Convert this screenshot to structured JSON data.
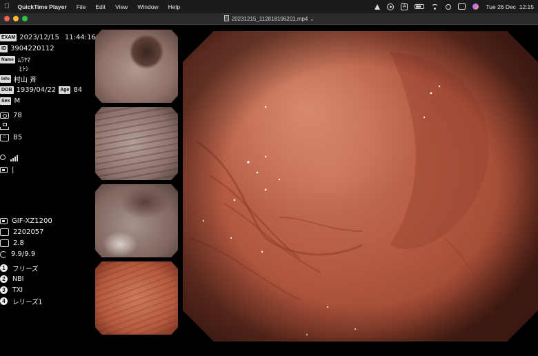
{
  "menubar": {
    "app_name": "QuickTime Player",
    "menus": [
      "File",
      "Edit",
      "View",
      "Window",
      "Help"
    ],
    "status_a_label": "A",
    "clock": "Tue 26 Dec  12:15"
  },
  "window": {
    "title": "20231215_112818106201.mp4",
    "title_chevron": "⌄"
  },
  "patient": {
    "exam_tag": "EXAM",
    "exam_date": "2023/12/15",
    "exam_time": "11:44:16",
    "id_tag": "ID",
    "id_value": "3904220112",
    "name_tag": "Name",
    "name_kana_family": "ﾑﾗﾔﾏ",
    "name_kana_given": "ﾋﾄｼ",
    "info_tag": "Info",
    "info_value": "村山 斉",
    "dob_tag": "DOB",
    "dob_value": "1939/04/22",
    "age_tag": "Age",
    "age_value": "84",
    "sex_tag": "Sex",
    "sex_value": "M"
  },
  "settings": {
    "camera_value": "78",
    "structure_value": "",
    "b_value": "B5",
    "signal_value": "",
    "misc_value": "|"
  },
  "scope": {
    "model": "GIF-XZ1200",
    "serial": "2202057",
    "zoom": "2.8",
    "ratio": "9.9/9.9"
  },
  "functions": [
    {
      "num": "1",
      "label": "フリーズ"
    },
    {
      "num": "2",
      "label": "NBI"
    },
    {
      "num": "3",
      "label": "TXI"
    },
    {
      "num": "4",
      "label": "レリーズ1"
    }
  ],
  "colors": {
    "menubar_bg": "#1b1b1d",
    "tissue_light": "#c9765c",
    "tissue_dark": "#7d3424",
    "thumb_grey": "#a78f87"
  }
}
